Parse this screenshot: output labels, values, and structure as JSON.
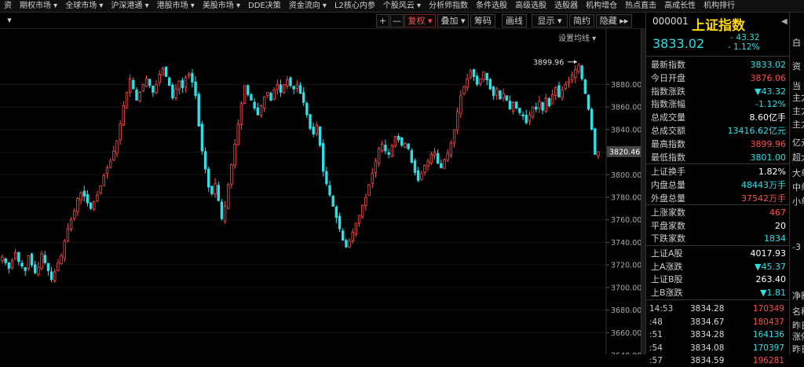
{
  "nav": [
    "资",
    "期权市场 ▾",
    "全球市场 ▾",
    "沪深港通 ▾",
    "港股市场 ▾",
    "美股市场 ▾",
    "DDE决策",
    "资金流向 ▾",
    "L2核心内参",
    "个股风云 ▾",
    "分析师指数",
    "条件选股",
    "高级选股",
    "选股器",
    "机构增仓",
    "热点直击",
    "高成长性",
    "机构排行"
  ],
  "toolbar": {
    "left_drop": "▾",
    "plus": "+",
    "minus": "—",
    "fuquan": "复权 ▾",
    "overlay": "叠加 ▾",
    "chips": "筹码",
    "line": "画线",
    "display": "显示 ▾",
    "simple": "简约",
    "hide": "隐藏 ▸▸",
    "set_ma": "设置均线 ▾"
  },
  "chart_data": {
    "type": "candlestick",
    "ylim": [
      3640,
      3920
    ],
    "yticks": [
      3880.0,
      3860.0,
      3840.0,
      3820.0,
      3800.0,
      3780.0,
      3760.0,
      3740.0,
      3720.0,
      3700.0,
      3680.0,
      3660.0,
      3640.0
    ],
    "current_value": "3820.46",
    "high_annotation": "3899.96",
    "colors": {
      "up": "#ff4d4d",
      "down": "#2ee0e6",
      "current_label_bg": "#444"
    },
    "closes": [
      3727,
      3722,
      3717,
      3724,
      3731,
      3723,
      3719,
      3715,
      3728,
      3720,
      3713,
      3718,
      3730,
      3722,
      3715,
      3707,
      3714,
      3722,
      3728,
      3741,
      3752,
      3760,
      3768,
      3779,
      3784,
      3781,
      3775,
      3770,
      3776,
      3782,
      3790,
      3799,
      3806,
      3812,
      3821,
      3830,
      3845,
      3861,
      3873,
      3885,
      3876,
      3866,
      3873,
      3880,
      3885,
      3879,
      3873,
      3880,
      3889,
      3894,
      3887,
      3879,
      3868,
      3876,
      3883,
      3877,
      3886,
      3889,
      3882,
      3870,
      3843,
      3821,
      3805,
      3789,
      3783,
      3792,
      3777,
      3761,
      3772,
      3791,
      3809,
      3827,
      3845,
      3863,
      3879,
      3871,
      3866,
      3859,
      3853,
      3861,
      3869,
      3873,
      3866,
      3875,
      3880,
      3873,
      3880,
      3884,
      3879,
      3876,
      3880,
      3872,
      3864,
      3853,
      3841,
      3836,
      3844,
      3826,
      3803,
      3792,
      3782,
      3772,
      3762,
      3752,
      3742,
      3736,
      3741,
      3749,
      3757,
      3764,
      3773,
      3780,
      3791,
      3801,
      3812,
      3823,
      3827,
      3821,
      3818,
      3826,
      3834,
      3831,
      3826,
      3828,
      3823,
      3811,
      3802,
      3795,
      3801,
      3808,
      3812,
      3818,
      3820,
      3810,
      3806,
      3813,
      3819,
      3828,
      3840,
      3856,
      3870,
      3878,
      3885,
      3892,
      3887,
      3880,
      3885,
      3891,
      3884,
      3876,
      3870,
      3876,
      3867,
      3872,
      3866,
      3858,
      3864,
      3859,
      3855,
      3852,
      3846,
      3853,
      3860,
      3858,
      3865,
      3857,
      3868,
      3861,
      3871,
      3877,
      3869,
      3875,
      3880,
      3883,
      3888,
      3893,
      3897,
      3885,
      3872,
      3858,
      3840,
      3818,
      3820.46
    ]
  },
  "quote": {
    "code": "000001",
    "name": "上证指数",
    "arrow": "◀",
    "price": "3833.02",
    "change": "- 43.32",
    "change_pct": "- 1.12%",
    "rows": [
      {
        "label": "最新指数",
        "value": "3833.02",
        "color": "#2ee0e6"
      },
      {
        "label": "今日开盘",
        "value": "3876.06",
        "color": "#ff4d4d"
      },
      {
        "label": "指数涨跌",
        "value": "▼43.32",
        "color": "#2ee0e6"
      },
      {
        "label": "指数涨幅",
        "value": "-1.12%",
        "color": "#2ee0e6"
      },
      {
        "label": "总成交量",
        "value": "8.60亿手",
        "color": "#ffffff"
      },
      {
        "label": "总成交额",
        "value": "13416.62亿元",
        "color": "#2ee0e6"
      },
      {
        "label": "最高指数",
        "value": "3899.96",
        "color": "#ff4d4d"
      },
      {
        "label": "最低指数",
        "value": "3801.00",
        "color": "#2ee0e6"
      },
      {
        "label": "上证换手",
        "value": "1.82%",
        "color": "#ffffff"
      },
      {
        "label": "内盘总量",
        "value": "48443万手",
        "color": "#2ee0e6"
      },
      {
        "label": "外盘总量",
        "value": "37542万手",
        "color": "#ff4d4d"
      },
      {
        "label": "上涨家数",
        "value": "467",
        "color": "#ff4d4d"
      },
      {
        "label": "平盘家数",
        "value": "20",
        "color": "#ffffff"
      },
      {
        "label": "下跌家数",
        "value": "1834",
        "color": "#2ee0e6"
      },
      {
        "label": "上证A股",
        "value": "4017.93",
        "color": "#ffffff"
      },
      {
        "label": "上A涨跌",
        "value": "▼45.37",
        "color": "#2ee0e6"
      },
      {
        "label": "上证B股",
        "value": "263.40",
        "color": "#ffffff"
      },
      {
        "label": "上B涨跌",
        "value": "▼1.81",
        "color": "#2ee0e6"
      }
    ],
    "ticks": [
      {
        "time": "14:53",
        "price": "3834.28",
        "volume": "170349",
        "vcolor": "#ff4d4d"
      },
      {
        "time": ":48",
        "price": "3834.67",
        "volume": "180437",
        "vcolor": "#ff4d4d"
      },
      {
        "time": ":51",
        "price": "3834.28",
        "volume": "164136",
        "vcolor": "#2ee0e6"
      },
      {
        "time": ":54",
        "price": "3834.08",
        "volume": "170397",
        "vcolor": "#2ee0e6"
      },
      {
        "time": ":57",
        "price": "3834.59",
        "volume": "196281",
        "vcolor": "#ff4d4d"
      }
    ]
  },
  "sliver": [
    "白",
    "资",
    "当",
    "主力",
    "主力",
    "主力",
    "亿元",
    "超大",
    "大单",
    "中单",
    "小单",
    "-3",
    "净额",
    "名称",
    "昨日",
    "涨停",
    "昨日"
  ]
}
